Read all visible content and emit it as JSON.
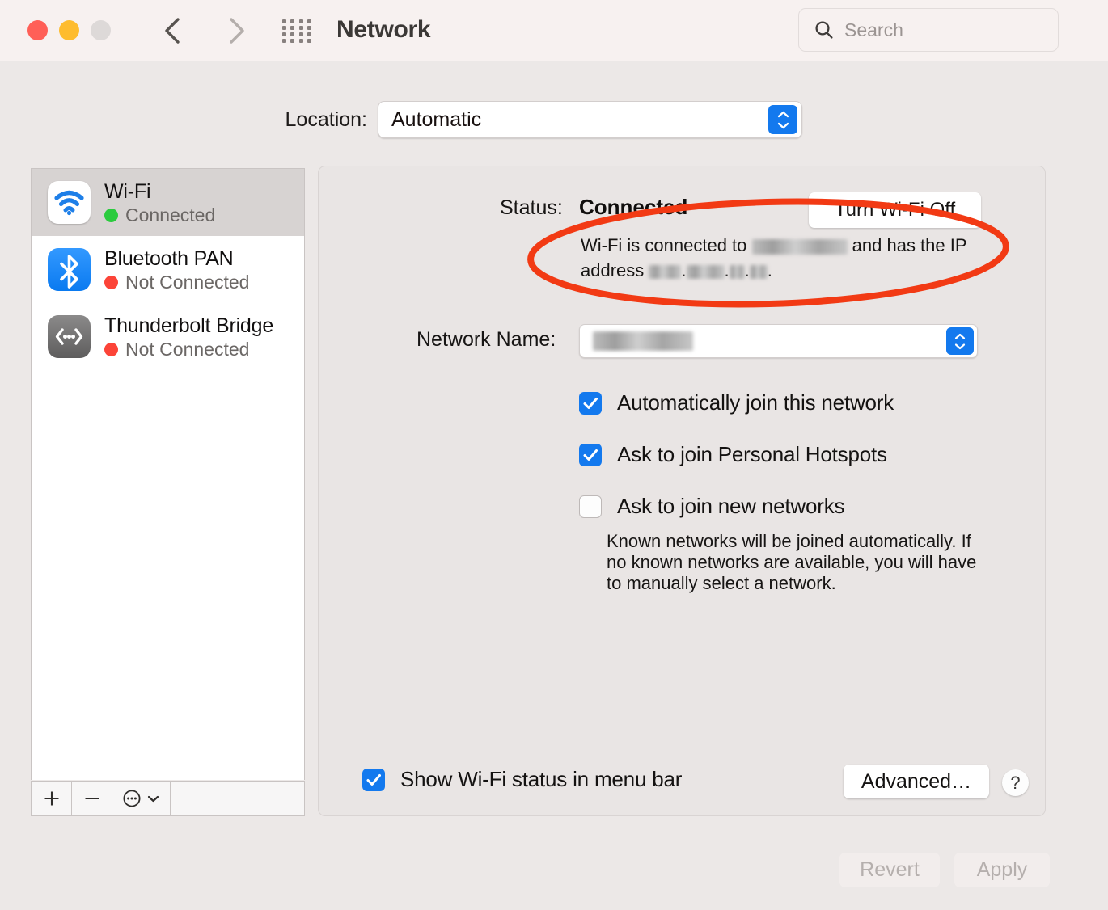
{
  "window": {
    "title": "Network",
    "traffic_lights": [
      "close",
      "minimize",
      "zoom"
    ]
  },
  "toolbar": {
    "back_icon": "chevron-left-icon",
    "forward_icon": "chevron-right-icon",
    "grid_icon": "grid-apps-icon",
    "search_placeholder": "Search",
    "search_value": ""
  },
  "location": {
    "label": "Location:",
    "value": "Automatic",
    "options": [
      "Automatic"
    ]
  },
  "sidebar": {
    "services": [
      {
        "name": "Wi-Fi",
        "status": "Connected",
        "status_color": "#2BCB3E",
        "icon": "wifi-icon",
        "selected": true
      },
      {
        "name": "Bluetooth PAN",
        "status": "Not Connected",
        "status_color": "#FC4438",
        "icon": "bluetooth-icon",
        "selected": false
      },
      {
        "name": "Thunderbolt Bridge",
        "status": "Not Connected",
        "status_color": "#FC4438",
        "icon": "thunderbolt-bridge-icon",
        "selected": false
      }
    ],
    "toolbar": {
      "add": "+",
      "remove": "−",
      "action_icon": "ellipsis-circle-icon",
      "action_chevron": "chevron-down-icon"
    }
  },
  "main": {
    "status_label": "Status:",
    "status_value": "Connected",
    "turn_off_button": "Turn Wi-Fi Off",
    "status_desc_part1": "Wi-Fi is connected to",
    "status_desc_part2": "and has the IP",
    "status_desc_part3": "address",
    "status_desc_redacted_ssid": "[redacted]",
    "status_desc_redacted_ip": "[redacted]",
    "network_name_label": "Network Name:",
    "network_name_value": "[redacted]",
    "checkboxes": [
      {
        "label": "Automatically join this network",
        "checked": true
      },
      {
        "label": "Ask to join Personal Hotspots",
        "checked": true
      },
      {
        "label": "Ask to join new networks",
        "checked": false
      }
    ],
    "help_text": "Known networks will be joined automatically. If no known networks are available, you will have to manually select a network.",
    "menubar_checkbox": {
      "label": "Show Wi-Fi status in menu bar",
      "checked": true
    },
    "advanced_button": "Advanced…",
    "help_button": "?"
  },
  "footer": {
    "revert_button": "Revert",
    "apply_button": "Apply"
  },
  "annotation": {
    "type": "ellipse",
    "color": "#F23A14",
    "target": "status description text"
  },
  "colors": {
    "accent_blue": "#1379EE",
    "connected_green": "#2BCB3E",
    "disconnected_red": "#FC4438",
    "annotation_red": "#F23A14",
    "window_bg": "#ECE8E7",
    "titlebar_bg": "#F7F1F0"
  }
}
